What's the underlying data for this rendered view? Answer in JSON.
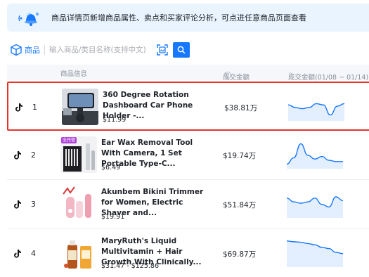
{
  "notice": {
    "text": "商品详情页新增商品属性、卖点和买家评论分析，可点进任意商品页面查看",
    "icon": "bell-icon"
  },
  "search": {
    "product_label": "商品",
    "placeholder": "输入商品/类目名称(支持中文)",
    "value": ""
  },
  "table": {
    "headers": {
      "info": "商品信息",
      "amount": "成交金额",
      "trend": "成交金额(01/08 ~ 01/14)"
    },
    "rows": [
      {
        "rank": "1",
        "title": "360 Degree Rotation Dashboard Car Phone Holder -...",
        "price": "$11.99",
        "amount": "$38.81万",
        "selected": true,
        "trend": [
          0.55,
          0.45,
          0.4,
          0.45,
          0.6,
          0.55,
          0.15,
          0.5,
          0.6
        ]
      },
      {
        "rank": "2",
        "title": "Ear Wax Removal Tool With Camera, 1 Set Portable Type-C...",
        "price": "$6.49",
        "amount": "$19.74万",
        "selected": false,
        "badge": "全托管",
        "trend": [
          0.1,
          0.35,
          0.9,
          0.45,
          0.3,
          0.4,
          0.25,
          0.2,
          0.2
        ]
      },
      {
        "rank": "3",
        "title": "Akunbem Bikini Trimmer for Women, Electric Shaver and...",
        "price": "$19.91",
        "amount": "$51.84万",
        "selected": false,
        "trend": [
          0.7,
          0.55,
          0.5,
          0.55,
          0.7,
          0.45,
          0.35,
          0.75,
          0.6
        ]
      },
      {
        "rank": "4",
        "title": "MaryRuth's Liquid Multivitamin + Hair Growth With Clinically...",
        "price": "$31.47 - $125.86",
        "amount": "$69.87万",
        "selected": false,
        "trend": [
          0.95,
          0.92,
          0.9,
          0.85,
          0.8,
          0.7,
          0.65,
          0.5,
          0.45
        ]
      }
    ]
  },
  "colors": {
    "accent": "#1677ff",
    "selected_border": "#e5332a",
    "trend_line": "#1677ff",
    "notice_bg": "#eaf4fe"
  }
}
